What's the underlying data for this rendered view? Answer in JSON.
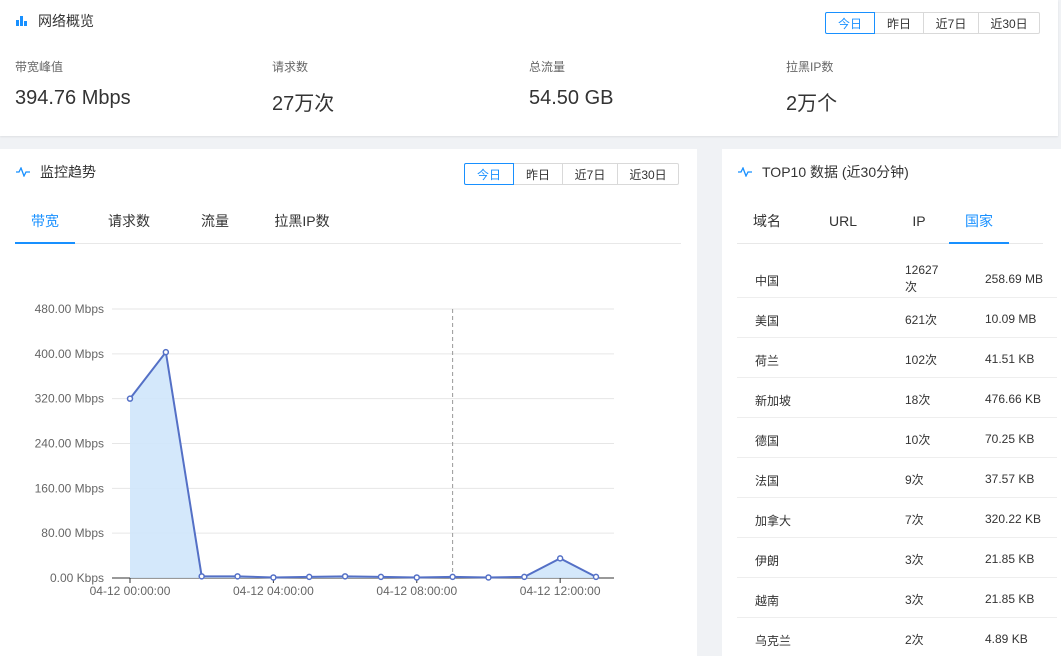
{
  "overview": {
    "title": "网络概览",
    "icon": "bar-chart-icon",
    "ranges": [
      "今日",
      "昨日",
      "近7日",
      "近30日"
    ],
    "active_range": 0,
    "stats": [
      {
        "label": "带宽峰值",
        "value": "394.76 Mbps"
      },
      {
        "label": "请求数",
        "value": "27万次"
      },
      {
        "label": "总流量",
        "value": "54.50 GB"
      },
      {
        "label": "拉黑IP数",
        "value": "2万个"
      }
    ]
  },
  "trend": {
    "title": "监控趋势",
    "icon": "pulse-icon",
    "ranges": [
      "今日",
      "昨日",
      "近7日",
      "近30日"
    ],
    "active_range": 0,
    "tabs": [
      "带宽",
      "请求数",
      "流量",
      "拉黑IP数"
    ],
    "active_tab": 0
  },
  "chart_data": {
    "type": "area",
    "y_ticks": [
      "0.00 Kbps",
      "80.00 Mbps",
      "160.00 Mbps",
      "240.00 Mbps",
      "320.00 Mbps",
      "400.00 Mbps",
      "480.00 Mbps"
    ],
    "x_ticks": [
      "04-12 00:00:00",
      "04-12 04:00:00",
      "04-12 08:00:00",
      "04-12 12:00:00"
    ],
    "ylim": [
      0,
      480
    ],
    "y_unit": "Mbps",
    "x_hours": [
      0,
      1,
      2,
      3,
      4,
      5,
      6,
      7,
      8,
      9,
      10,
      11,
      12,
      13
    ],
    "values": [
      320,
      403,
      3,
      3,
      1,
      2,
      3,
      2,
      1,
      2,
      1,
      2,
      35,
      2
    ],
    "hover_hour": 9,
    "line_color": "#5470c6",
    "fill_color": "#cfe6fb",
    "grid": true
  },
  "top10": {
    "title": "TOP10 数据 (近30分钟)",
    "icon": "pulse-icon",
    "tabs": [
      "域名",
      "URL",
      "IP",
      "国家"
    ],
    "active_tab": 3,
    "rows": [
      {
        "name": "中国",
        "count": "12627次",
        "flow": "258.69 MB"
      },
      {
        "name": "美国",
        "count": "621次",
        "flow": "10.09 MB"
      },
      {
        "name": "荷兰",
        "count": "102次",
        "flow": "41.51 KB"
      },
      {
        "name": "新加坡",
        "count": "18次",
        "flow": "476.66 KB"
      },
      {
        "name": "德国",
        "count": "10次",
        "flow": "70.25 KB"
      },
      {
        "name": "法国",
        "count": "9次",
        "flow": "37.57 KB"
      },
      {
        "name": "加拿大",
        "count": "7次",
        "flow": "320.22 KB"
      },
      {
        "name": "伊朗",
        "count": "3次",
        "flow": "21.85 KB"
      },
      {
        "name": "越南",
        "count": "3次",
        "flow": "21.85 KB"
      },
      {
        "name": "乌克兰",
        "count": "2次",
        "flow": "4.89 KB"
      }
    ]
  }
}
